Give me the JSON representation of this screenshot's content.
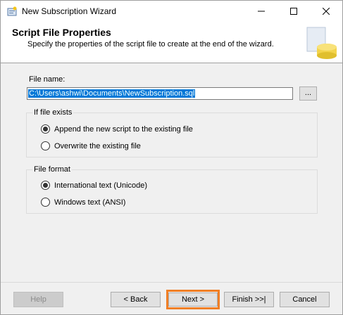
{
  "window": {
    "title": "New Subscription Wizard",
    "minimize_symbol": "—",
    "maximize_symbol": "☐",
    "close_symbol": "✕"
  },
  "header": {
    "title": "Script File Properties",
    "subtitle": "Specify the properties of the script file to create at the end of the wizard."
  },
  "file": {
    "label": "File name:",
    "value": "C:\\Users\\ashwi\\Documents\\NewSubscription.sql",
    "browse_label": "..."
  },
  "if_file_exists": {
    "legend": "If file exists",
    "options": [
      {
        "label": "Append the new script to the existing file",
        "selected": true
      },
      {
        "label": "Overwrite the existing file",
        "selected": false
      }
    ]
  },
  "file_format": {
    "legend": "File format",
    "options": [
      {
        "label": "International text (Unicode)",
        "selected": true
      },
      {
        "label": "Windows text (ANSI)",
        "selected": false
      }
    ]
  },
  "footer": {
    "help": "Help",
    "back": "< Back",
    "next": "Next >",
    "finish": "Finish >>|",
    "cancel": "Cancel"
  },
  "colors": {
    "highlight": "#f07f26",
    "selection": "#0078d7"
  }
}
